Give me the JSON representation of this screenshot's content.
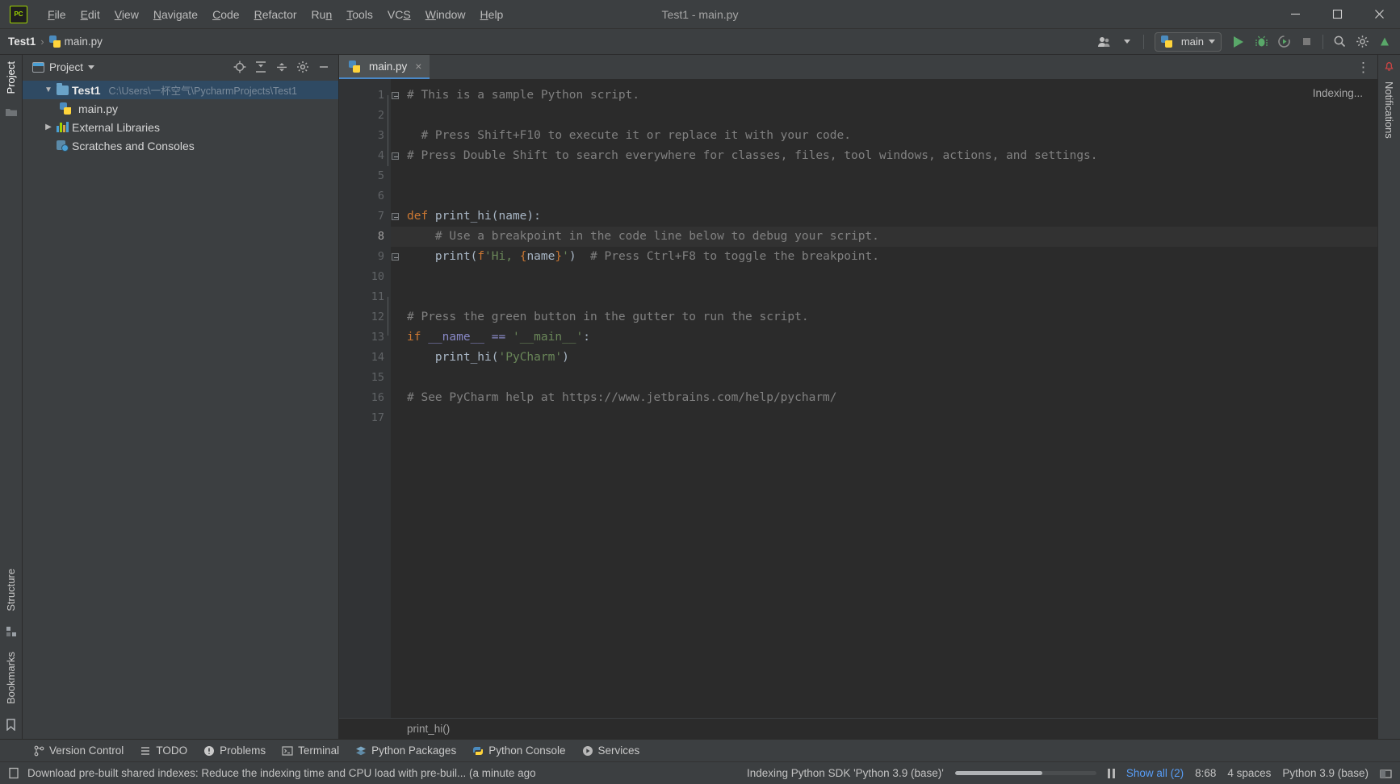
{
  "window": {
    "title": "Test1 - main.py",
    "minimize_label": "Minimize",
    "maximize_label": "Maximize",
    "close_label": "Close"
  },
  "menu": [
    {
      "label": "File",
      "mnemonic": "F"
    },
    {
      "label": "Edit",
      "mnemonic": "E"
    },
    {
      "label": "View",
      "mnemonic": "V"
    },
    {
      "label": "Navigate",
      "mnemonic": "N"
    },
    {
      "label": "Code",
      "mnemonic": "C"
    },
    {
      "label": "Refactor",
      "mnemonic": "R"
    },
    {
      "label": "Run",
      "mnemonic": "n"
    },
    {
      "label": "Tools",
      "mnemonic": "T"
    },
    {
      "label": "VCS",
      "mnemonic": "S"
    },
    {
      "label": "Window",
      "mnemonic": "W"
    },
    {
      "label": "Help",
      "mnemonic": "H"
    }
  ],
  "navbar": {
    "breadcrumbs": [
      "Test1",
      "main.py"
    ],
    "separator": "›",
    "run_config": "main",
    "icons": [
      "user-avatar-icon",
      "run-icon",
      "debug-icon",
      "run-with-coverage-icon",
      "stop-icon",
      "search-icon",
      "settings-icon",
      "updates-icon"
    ]
  },
  "left_rail": {
    "top_tab": "Project",
    "bottom_tabs": [
      "Structure",
      "Bookmarks"
    ]
  },
  "right_rail": {
    "tab": "Notifications"
  },
  "project_panel": {
    "title": "Project",
    "toolbar_icons": [
      "locate-icon",
      "expand-all-icon",
      "collapse-all-icon",
      "settings-icon",
      "hide-icon"
    ],
    "tree": [
      {
        "name": "Test1",
        "path": "C:\\Users\\一杯空气\\PycharmProjects\\Test1",
        "kind": "project-root",
        "selected": true,
        "expanded": true
      },
      {
        "name": "main.py",
        "path": "",
        "kind": "python-file",
        "selected": false,
        "expanded": false
      },
      {
        "name": "External Libraries",
        "path": "",
        "kind": "libraries",
        "selected": false,
        "expanded": false
      },
      {
        "name": "Scratches and Consoles",
        "path": "",
        "kind": "scratches",
        "selected": false,
        "expanded": false
      }
    ]
  },
  "editor": {
    "tabs": [
      {
        "label": "main.py",
        "active": true,
        "close_label": "×"
      }
    ],
    "options_label": "⋮",
    "status_overlay": "Indexing...",
    "breadcrumb": "print_hi()",
    "current_line": 8,
    "lines": [
      {
        "n": 1,
        "tokens": [
          {
            "t": "# This is a sample Python script.",
            "c": "cmt"
          }
        ]
      },
      {
        "n": 2,
        "tokens": []
      },
      {
        "n": 3,
        "tokens": [
          {
            "t": "  # Press Shift+F10 to execute it or replace it with your code.",
            "c": "cmt"
          }
        ]
      },
      {
        "n": 4,
        "tokens": [
          {
            "t": "# Press Double Shift to search everywhere for classes, files, tool windows, actions, and settings.",
            "c": "cmt"
          }
        ]
      },
      {
        "n": 5,
        "tokens": []
      },
      {
        "n": 6,
        "tokens": []
      },
      {
        "n": 7,
        "tokens": [
          {
            "t": "def ",
            "c": "kw"
          },
          {
            "t": "print_hi(name):",
            "c": "fn"
          }
        ]
      },
      {
        "n": 8,
        "tokens": [
          {
            "t": "    # Use a breakpoint in the code line below to debug your script.",
            "c": "cmt"
          }
        ]
      },
      {
        "n": 9,
        "tokens": [
          {
            "t": "    print(",
            "c": "fn"
          },
          {
            "t": "f",
            "c": "fprefix"
          },
          {
            "t": "'Hi, ",
            "c": "str"
          },
          {
            "t": "{",
            "c": "fbrace"
          },
          {
            "t": "name",
            "c": "fname"
          },
          {
            "t": "}",
            "c": "fbrace"
          },
          {
            "t": "'",
            "c": "str"
          },
          {
            "t": ")  ",
            "c": "fn"
          },
          {
            "t": "# Press Ctrl+F8 to toggle the breakpoint.",
            "c": "cmt"
          }
        ]
      },
      {
        "n": 10,
        "tokens": []
      },
      {
        "n": 11,
        "tokens": []
      },
      {
        "n": 12,
        "tokens": [
          {
            "t": "# Press the green button in the gutter to run the script.",
            "c": "cmt"
          }
        ]
      },
      {
        "n": 13,
        "tokens": [
          {
            "t": "if ",
            "c": "kw"
          },
          {
            "t": "__name__ == ",
            "c": "builtin"
          },
          {
            "t": "'__main__'",
            "c": "str"
          },
          {
            "t": ":",
            "c": "fn"
          }
        ]
      },
      {
        "n": 14,
        "tokens": [
          {
            "t": "    print_hi(",
            "c": "fn"
          },
          {
            "t": "'PyCharm'",
            "c": "str"
          },
          {
            "t": ")",
            "c": "fn"
          }
        ]
      },
      {
        "n": 15,
        "tokens": []
      },
      {
        "n": 16,
        "tokens": [
          {
            "t": "# See PyCharm help at https://www.jetbrains.com/help/pycharm/",
            "c": "cmt"
          }
        ]
      },
      {
        "n": 17,
        "tokens": []
      }
    ]
  },
  "tool_windows": [
    {
      "label": "Version Control",
      "icon": "branch-icon"
    },
    {
      "label": "TODO",
      "icon": "list-icon"
    },
    {
      "label": "Problems",
      "icon": "warning-icon"
    },
    {
      "label": "Terminal",
      "icon": "terminal-icon"
    },
    {
      "label": "Python Packages",
      "icon": "packages-icon"
    },
    {
      "label": "Python Console",
      "icon": "python-icon"
    },
    {
      "label": "Services",
      "icon": "services-icon"
    }
  ],
  "statusbar": {
    "notification_icon": "ide-message-icon",
    "message": "Download pre-built shared indexes: Reduce the indexing time and CPU load with pre-buil... (a minute ago",
    "task": "Indexing Python SDK 'Python 3.9 (base)'",
    "progress_percent": 62,
    "pause_label": "Pause",
    "show_all": "Show all (2)",
    "caret": "8:68",
    "indent": "4 spaces",
    "interpreter": "Python 3.9 (base)",
    "trailing_icon": "event-log-icon"
  },
  "colors": {
    "background": "#3c3f41",
    "editor_bg": "#2b2b2b",
    "gutter_bg": "#313335",
    "selection": "#2f4a63",
    "accent": "#4a88c7",
    "link": "#589df6",
    "comment": "#808080",
    "keyword": "#cc7832",
    "string": "#6a8759",
    "code_fg": "#a9b7c6",
    "run_green": "#59a869"
  }
}
